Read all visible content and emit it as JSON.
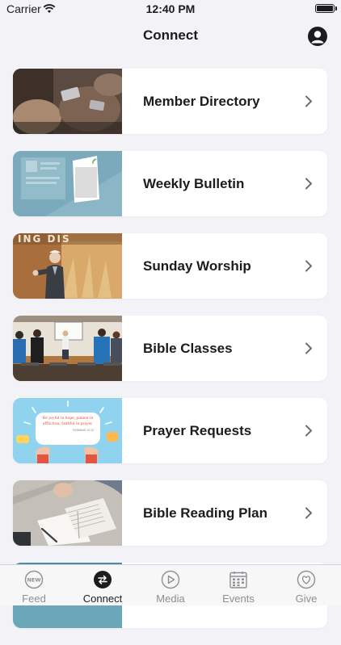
{
  "status_bar": {
    "carrier": "Carrier",
    "time": "12:40 PM"
  },
  "nav": {
    "title": "Connect",
    "profile_icon": "person-circle-icon"
  },
  "items": [
    {
      "label": "Member Directory"
    },
    {
      "label": "Weekly Bulletin"
    },
    {
      "label": "Sunday Worship"
    },
    {
      "label": "Bible Classes"
    },
    {
      "label": "Prayer Requests",
      "thumb_text": "Be joyful in hope, patient in affliction, faithful in prayer.",
      "thumb_ref": "ROMANS 12:12"
    },
    {
      "label": "Bible Reading Plan"
    }
  ],
  "worship_banner_text": "ING DIS",
  "tabs": [
    {
      "label": "Feed",
      "icon": "new-badge-icon",
      "badge": "NEW"
    },
    {
      "label": "Connect",
      "icon": "connect-arrows-icon",
      "active": true
    },
    {
      "label": "Media",
      "icon": "play-circle-icon"
    },
    {
      "label": "Events",
      "icon": "calendar-icon"
    },
    {
      "label": "Give",
      "icon": "heart-circle-icon"
    }
  ],
  "colors": {
    "background": "#f2f2f7",
    "card": "#ffffff",
    "text": "#1c1c1e",
    "inactive_tab": "#8e8e93",
    "bulletin_teal": "#8ab6c5"
  }
}
